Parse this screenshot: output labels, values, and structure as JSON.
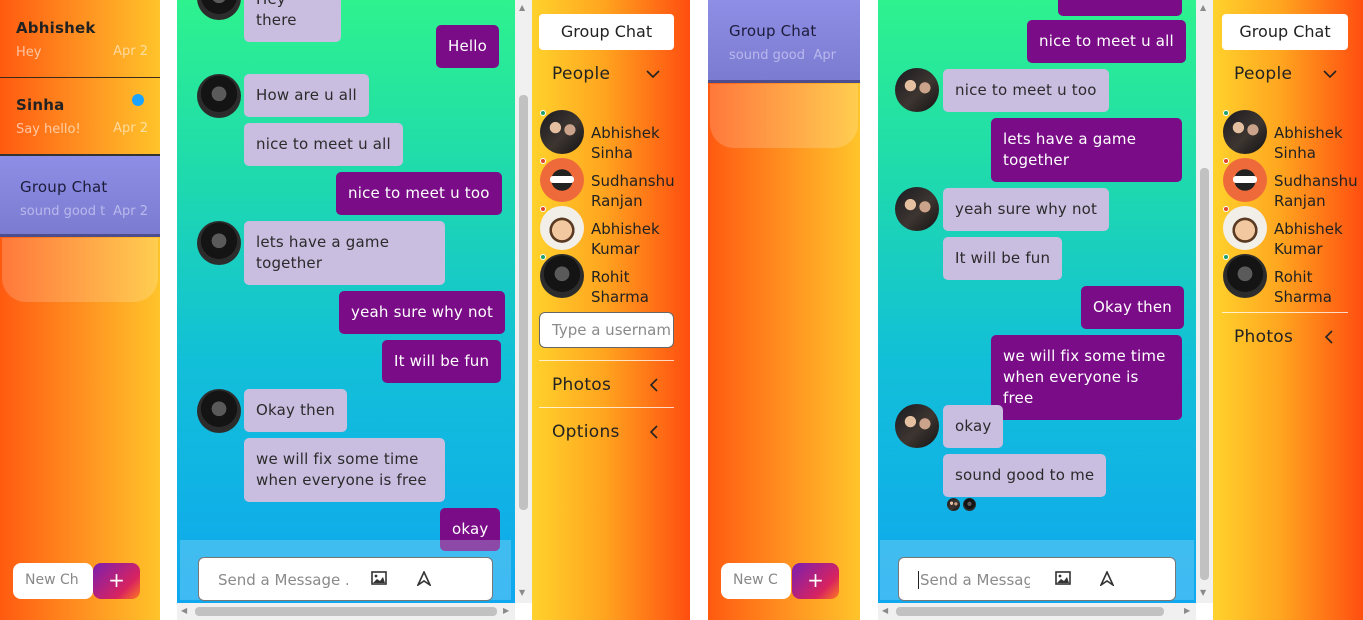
{
  "left_window": {
    "conversations": [
      {
        "name": "Abhishek",
        "preview": "Hey",
        "date": "Apr 2"
      },
      {
        "name": "Sinha",
        "preview": "Say hello!",
        "date": "Apr 2",
        "unread": true
      },
      {
        "name": "Group Chat",
        "preview": "sound good t",
        "date": "Apr 2",
        "active": true
      }
    ],
    "new_chat_placeholder": "New Ch",
    "plus_label": "+",
    "messages": [
      {
        "dir": "in",
        "text": "Hey there"
      },
      {
        "dir": "out",
        "text": "Hello"
      },
      {
        "dir": "in",
        "text": "How are u all"
      },
      {
        "dir": "in",
        "text": "nice to meet u all"
      },
      {
        "dir": "out",
        "text": "nice to meet u too"
      },
      {
        "dir": "in",
        "text": "lets have a game together"
      },
      {
        "dir": "out",
        "text": "yeah sure why not"
      },
      {
        "dir": "out",
        "text": "It will be fun"
      },
      {
        "dir": "in",
        "text": "Okay then"
      },
      {
        "dir": "in",
        "text": "we will fix some time when everyone is free"
      },
      {
        "dir": "out",
        "text": "okay"
      }
    ],
    "composer_placeholder": "Send a Message .",
    "details": {
      "group_button": "Group Chat",
      "people_label": "People",
      "members": [
        {
          "first": "Abhishek",
          "last": "Sinha",
          "status": "online"
        },
        {
          "first": "Sudhanshu",
          "last": "Ranjan",
          "status": "offline"
        },
        {
          "first": "Abhishek",
          "last": "Kumar",
          "status": "offline"
        },
        {
          "first": "Rohit",
          "last": "Sharma",
          "status": "online"
        }
      ],
      "username_placeholder": "Type a usernam",
      "photos_label": "Photos",
      "options_label": "Options"
    }
  },
  "right_window": {
    "conversations": [
      {
        "name": "Group Chat",
        "preview": "sound good",
        "date": "Apr",
        "active": true
      }
    ],
    "new_chat_placeholder": "New C",
    "plus_label": "+",
    "messages": [
      {
        "dir": "out",
        "text": "nice to meet u all"
      },
      {
        "dir": "in",
        "text": "nice to meet u too"
      },
      {
        "dir": "out",
        "text": "lets have a game together"
      },
      {
        "dir": "in",
        "text": "yeah sure why not"
      },
      {
        "dir": "in",
        "text": "It will be fun"
      },
      {
        "dir": "out",
        "text": "Okay then"
      },
      {
        "dir": "out",
        "text": "we will fix some time when everyone is free"
      },
      {
        "dir": "in",
        "text": "okay"
      },
      {
        "dir": "in",
        "text": "sound good to me"
      }
    ],
    "composer_placeholder": "Send a Messag",
    "details": {
      "group_button": "Group Chat",
      "people_label": "People",
      "members": [
        {
          "first": "Abhishek",
          "last": "Sinha",
          "status": "online"
        },
        {
          "first": "Sudhanshu",
          "last": "Ranjan",
          "status": "offline"
        },
        {
          "first": "Abhishek",
          "last": "Kumar",
          "status": "offline"
        },
        {
          "first": "Rohit",
          "last": "Sharma",
          "status": "online"
        }
      ],
      "photos_label": "Photos"
    }
  },
  "icons": {
    "image": "image-icon",
    "send": "send-icon",
    "chevron_down": "chevron-down-icon",
    "chevron_left": "chevron-left-icon"
  },
  "colors": {
    "outgoing": "#7a0d87",
    "incoming": "#c9bde0",
    "online": "#1e9e6a",
    "offline": "#e0472a",
    "unread": "#1aa3ff"
  }
}
